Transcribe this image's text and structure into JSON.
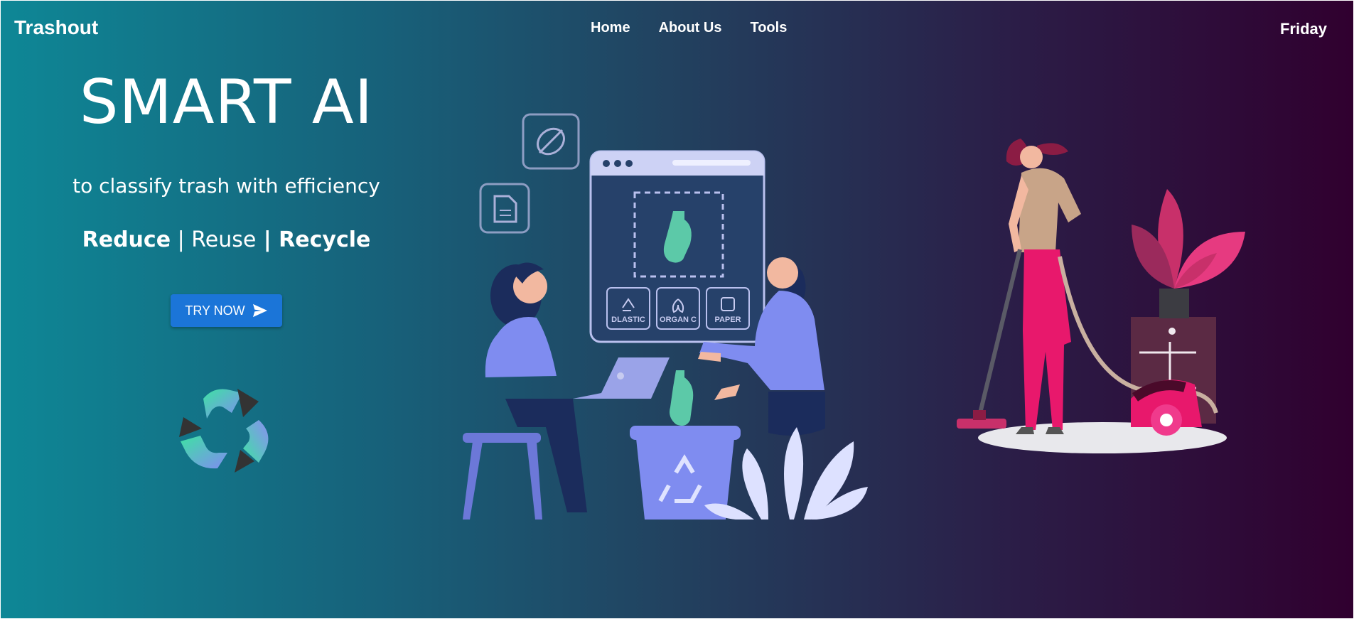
{
  "brand": "Trashout",
  "nav": {
    "items": [
      {
        "label": "Home"
      },
      {
        "label": "About Us"
      },
      {
        "label": "Tools"
      }
    ],
    "day": "Friday"
  },
  "hero": {
    "headline": "SMART AI",
    "subheading": "to classify trash with efficiency",
    "slogan": {
      "reduce": "Reduce",
      "sep1": " | ",
      "reuse": "Reuse",
      "sep2": " | ",
      "recycle": "Recycle"
    },
    "cta_label": "TRY NOW"
  },
  "illustration": {
    "labels": [
      "DLASTIC",
      "ORGAN C",
      "PAPER"
    ]
  },
  "colors": {
    "gradient_start": "#0e8796",
    "gradient_end": "#30002f",
    "button": "#1b75d8"
  }
}
